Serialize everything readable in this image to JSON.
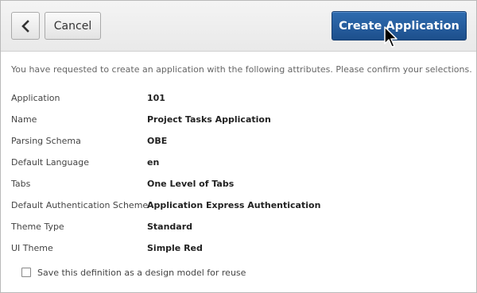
{
  "toolbar": {
    "back_icon": "chevron-left-icon",
    "cancel_label": "Cancel",
    "create_label": "Create Application"
  },
  "intro_text": "You have requested to create an application with the following attributes. Please confirm your selections.",
  "attributes": [
    {
      "label": "Application",
      "value": "101"
    },
    {
      "label": "Name",
      "value": "Project Tasks Application"
    },
    {
      "label": "Parsing Schema",
      "value": "OBE"
    },
    {
      "label": "Default Language",
      "value": "en"
    },
    {
      "label": "Tabs",
      "value": "One Level of Tabs"
    },
    {
      "label": "Default Authentication Scheme",
      "value": "Application Express Authentication"
    },
    {
      "label": "Theme Type",
      "value": "Standard"
    },
    {
      "label": "UI Theme",
      "value": "Simple Red"
    }
  ],
  "save_definition": {
    "label": "Save this definition as a design model for reuse",
    "checked": false
  },
  "colors": {
    "primary_button": "#1d4f8c",
    "toolbar_bg": "#eeeeee"
  }
}
